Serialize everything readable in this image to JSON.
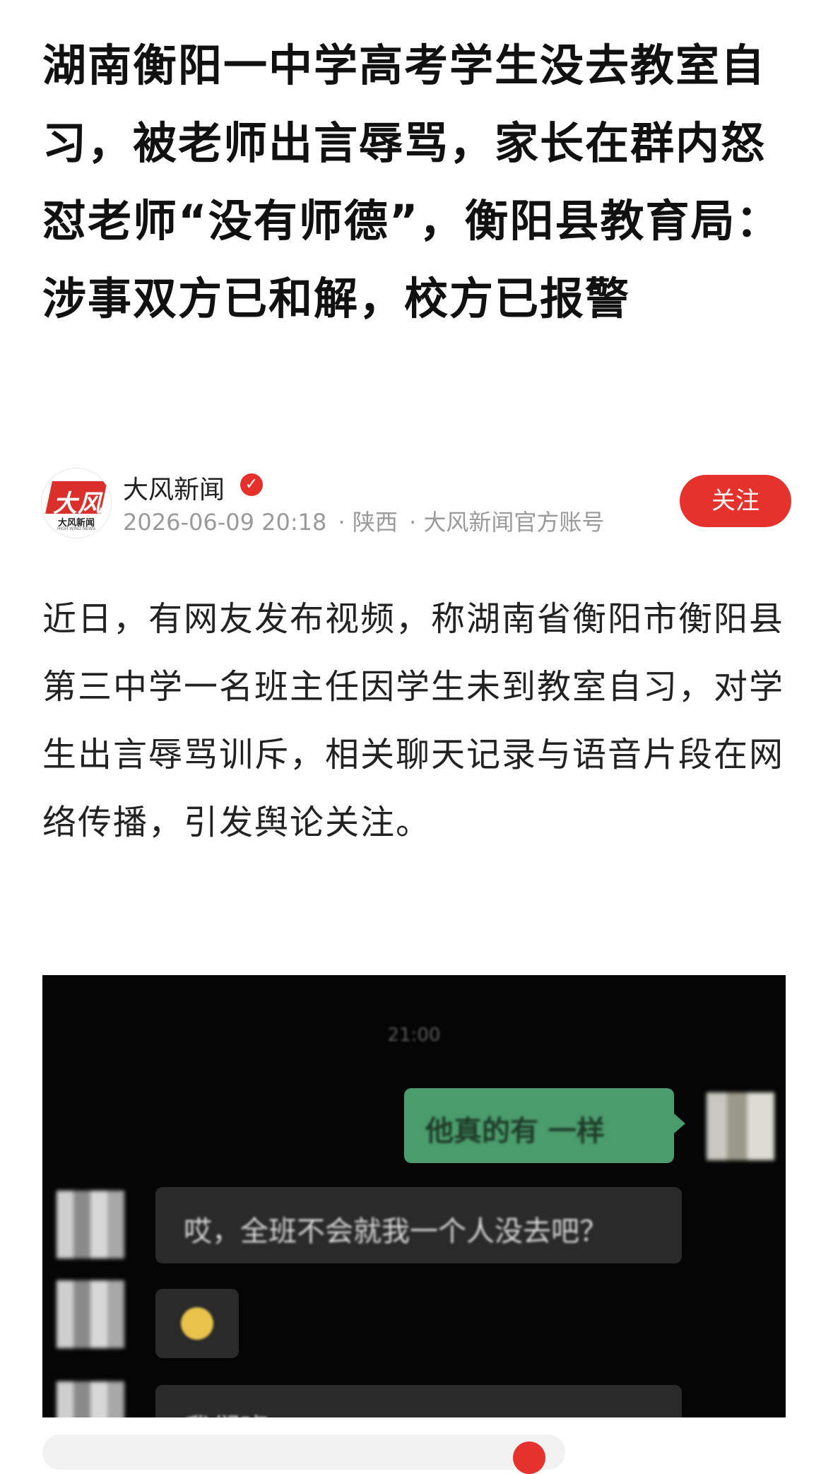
{
  "article": {
    "title": "湖南衡阳一中学高考学生没去教室自习，被老师出言辱骂，家长在群内怒怼老师“没有师德”，衡阳县教育局：涉事双方已和解，校方已报警",
    "body": "近日，有网友发布视频，称湖南省衡阳市衡阳县第三中学一名班主任因学生未到教室自习，对学生出言辱骂训斥，相关聊天记录与语音片段在网络传播，引发舆论关注。"
  },
  "author": {
    "name": "大风新闻",
    "logo_text": "大风",
    "logo_sub": "大风新闻",
    "logo_sub_en": "HIGH WIND NEWS",
    "verified_glyph": "✓",
    "timestamp": "2026-06-09 20:18",
    "location": "· 陕西",
    "account_label": "· 大风新闻官方账号",
    "follow_label": "关注"
  },
  "chat_image": {
    "time": "21:00",
    "outgoing_message": "他真的有 一样",
    "incoming_message_1": "哎，全班不会就我一个人没去吧？",
    "incoming_message_3": "我们班…"
  },
  "colors": {
    "accent_red": "#e5322d",
    "chat_green": "#4a9c6c"
  }
}
